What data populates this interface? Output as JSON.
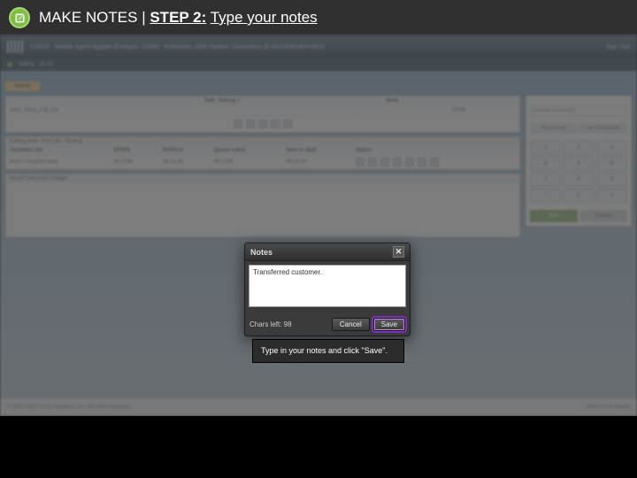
{
  "header": {
    "title_left": "MAKE NOTES",
    "separator": " | ",
    "step_label": "STEP 2:",
    "step_desc": "Type your notes"
  },
  "cisco": {
    "brand": "CISCO",
    "title": "Mobile Agent Agapito Enriquez (1004) - Extension 1004 (Nailed Connection @ 4411506140==001)",
    "signout": "Sign Out",
    "status": "Talking",
    "time": "00:21",
    "home_tab": "Home",
    "main_table": {
      "headers": [
        "",
        "Talk: Talking >",
        "",
        "Hold",
        ""
      ],
      "row": [
        "5001_Price_Fall_EN",
        "-",
        "-",
        "-",
        "00:05"
      ]
    },
    "section1": "Calling from: TestCall—Testing",
    "detail_headers": [
      "Variables Set",
      "EP/DN",
      "PG/Pent",
      "Queue Label",
      "Sent to Skill",
      "Status"
    ],
    "detail_row": [
      "test1—Asigned test1",
      "45,7295",
      "30,21,35",
      "45,7295",
      "08:03:15",
      ""
    ],
    "section2": "Cloud Transcript Gadget",
    "side": {
      "queue_label": "Choose a Country",
      "tabs": [
        "Phone book",
        "ext: 5103499203"
      ],
      "dial": [
        "1",
        "2",
        "3",
        "4",
        "5",
        "6",
        "7",
        "8",
        "9",
        "*",
        "0",
        "#"
      ],
      "call": "Call",
      "cancel": "Cancel"
    },
    "footer_left": "© 2010-2012 Cisco Systems, Inc. All rights reserved.",
    "footer_right": "Send Error Report"
  },
  "notes": {
    "title": "Notes",
    "content": "Transferred customer.",
    "chars_left": "Chars left: 98",
    "cancel": "Cancel",
    "save": "Save"
  },
  "tooltip": {
    "text": "Type in your notes and click \"Save\"."
  }
}
